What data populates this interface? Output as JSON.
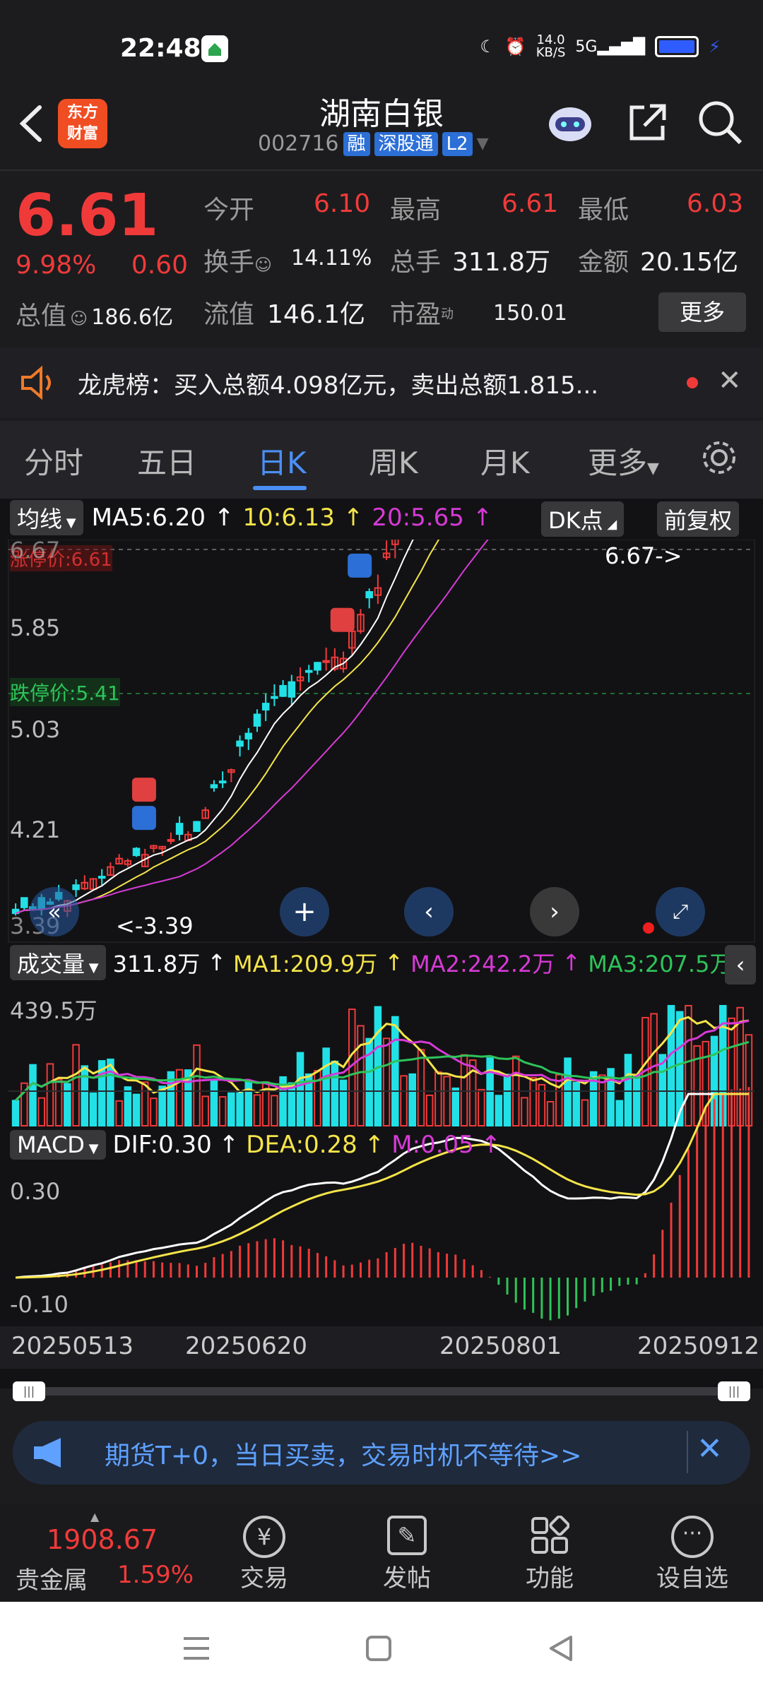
{
  "status": {
    "time": "22:48",
    "net_speed_top": "14.0",
    "net_speed_unit": "KB/S",
    "signal": "5G"
  },
  "header": {
    "title": "湖南白银",
    "code": "002716",
    "tag1": "融",
    "tag2": "深股通",
    "tag3": "L2",
    "logo_line1": "东方",
    "logo_line2": "财富"
  },
  "quote": {
    "price": "6.61",
    "pct": "9.98%",
    "change": "0.60",
    "open_label": "今开",
    "open": "6.10",
    "high_label": "最高",
    "high": "6.61",
    "low_label": "最低",
    "low": "6.03",
    "turnover_label": "换手",
    "turnover": "14.11%",
    "volume_label": "总手",
    "volume": "311.8万",
    "amount_label": "金额",
    "amount": "20.15亿",
    "mktcap_label": "总值",
    "mktcap": "186.6亿",
    "float_label": "流值",
    "float": "146.1亿",
    "pe_label": "市盈",
    "pe_sup": "动",
    "pe": "150.01",
    "more": "更多"
  },
  "notice": {
    "text": "龙虎榜：买入总额4.098亿元，卖出总额1.815..."
  },
  "tabs": [
    "分时",
    "五日",
    "日K",
    "周K",
    "月K",
    "更多"
  ],
  "kline": {
    "ma_selector": "均线",
    "ma5": "MA5:6.20",
    "ma10": "10:6.13",
    "ma20": "20:5.65",
    "dk_button": "DK点",
    "adj_button": "前复权",
    "limit_up_label": "涨停价:6.61",
    "limit_down_label": "跌停价:5.41",
    "y_ticks": [
      "6.67",
      "5.85",
      "5.03",
      "4.21",
      "3.39"
    ],
    "max_marker": "6.67->",
    "min_marker": "<-3.39"
  },
  "volume": {
    "selector": "成交量",
    "vol": "311.8万",
    "ma1": "MA1:209.9万",
    "ma2": "MA2:242.2万",
    "ma3": "MA3:207.5万",
    "max_tick": "439.5万"
  },
  "macd": {
    "selector": "MACD",
    "dif": "DIF:0.30",
    "dea": "DEA:0.28",
    "m": "M:0.05",
    "top_tick": "0.30",
    "bottom_tick": "-0.10"
  },
  "dates": [
    "20250513",
    "20250620",
    "20250801",
    "20250912"
  ],
  "ad": {
    "text": "期货T+0，当日买卖，交易时机不等待>>"
  },
  "bottom": {
    "index_value": "1908.67",
    "index_name": "贵金属",
    "index_pct": "1.59%",
    "trade": "交易",
    "post": "发帖",
    "func": "功能",
    "watch": "设自选"
  },
  "colors": {
    "up": "#f03a3a",
    "down": "#22e1e6",
    "accent": "#4b8ff5",
    "ma5": "#ffffff",
    "ma10": "#f5e44a",
    "ma20": "#d63ad6"
  }
}
